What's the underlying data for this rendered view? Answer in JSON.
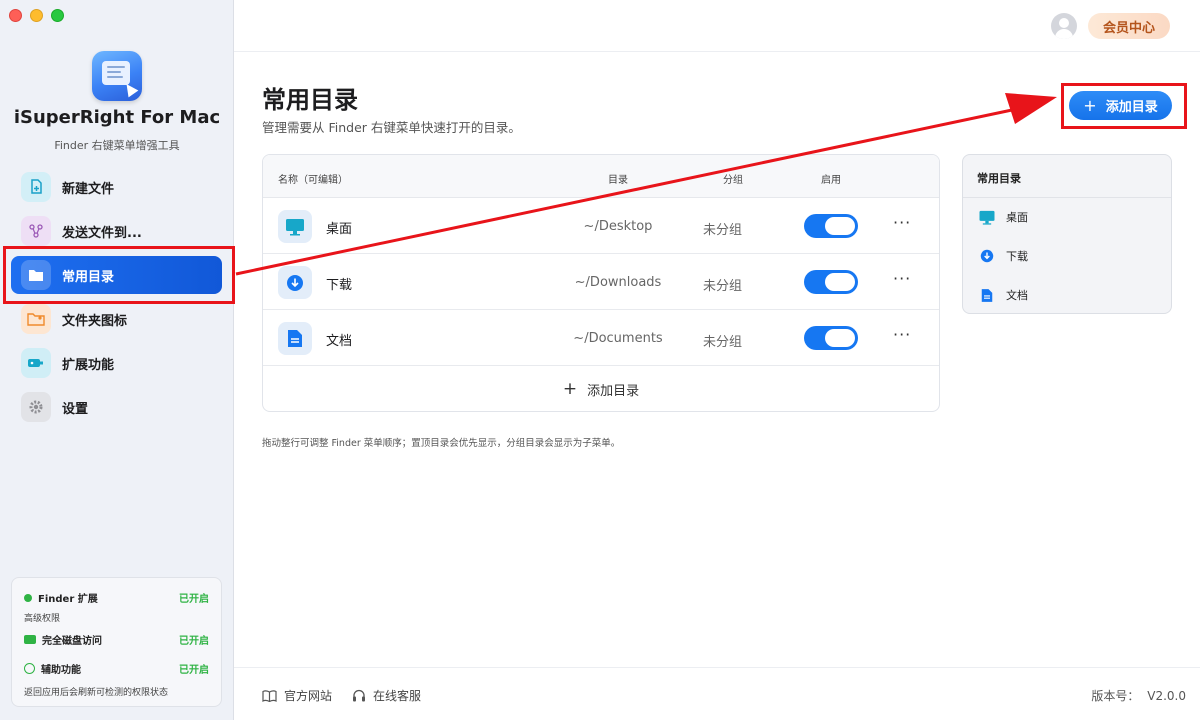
{
  "app": {
    "name": "iSuperRight For Mac",
    "subtitle": "Finder 右键菜单增强工具"
  },
  "sidebar": {
    "items": [
      {
        "label": "新建文件",
        "icon": "new-file-icon",
        "color": "#1aa1c8",
        "active": false
      },
      {
        "label": "发送文件到...",
        "icon": "send-file-icon",
        "color": "#9b59b6",
        "active": false
      },
      {
        "label": "常用目录",
        "icon": "folder-icon",
        "color": "#ffffff",
        "active": true
      },
      {
        "label": "文件夹图标",
        "icon": "folder-image-icon",
        "color": "#f08a2c",
        "active": false
      },
      {
        "label": "扩展功能",
        "icon": "extension-icon",
        "color": "#17a7c9",
        "active": false
      },
      {
        "label": "设置",
        "icon": "gear-icon",
        "color": "#8e8e93",
        "active": false
      }
    ]
  },
  "permissions": {
    "finder_label": "Finder 扩展",
    "finder_status": "已开启",
    "section_label": "高级权限",
    "disk_label": "完全磁盘访问",
    "disk_status": "已开启",
    "access_label": "辅助功能",
    "access_status": "已开启",
    "note": "返回应用后会刷新可检测的权限状态"
  },
  "header": {
    "vip_label": "会员中心"
  },
  "page": {
    "title": "常用目录",
    "description": "管理需要从 Finder 右键菜单快速打开的目录。",
    "add_button": "添加目录"
  },
  "table": {
    "columns": [
      "名称（可编辑）",
      "目录",
      "分组",
      "启用"
    ],
    "rows": [
      {
        "name": "桌面",
        "path": "~/Desktop",
        "group": "未分组",
        "enabled": true,
        "icon": "desktop-icon"
      },
      {
        "name": "下载",
        "path": "~/Downloads",
        "group": "未分组",
        "enabled": true,
        "icon": "download-icon"
      },
      {
        "name": "文档",
        "path": "~/Documents",
        "group": "未分组",
        "enabled": true,
        "icon": "document-icon"
      }
    ],
    "more_label": "···",
    "add_row_label": "添加目录"
  },
  "tip": "拖动整行可调整 Finder 菜单顺序；置顶目录会优先显示，分组目录会显示为子菜单。",
  "preview": {
    "title": "常用目录",
    "items": [
      {
        "label": "桌面",
        "icon": "desktop-icon"
      },
      {
        "label": "下载",
        "icon": "download-icon"
      },
      {
        "label": "文档",
        "icon": "document-icon"
      }
    ]
  },
  "footer": {
    "website_label": "官方网站",
    "support_label": "在线客服",
    "version_label": "版本号：",
    "version": "V2.0.0"
  },
  "colors": {
    "accent": "#1677f2",
    "annotation": "#e8141a",
    "status_on": "#2fb344"
  }
}
